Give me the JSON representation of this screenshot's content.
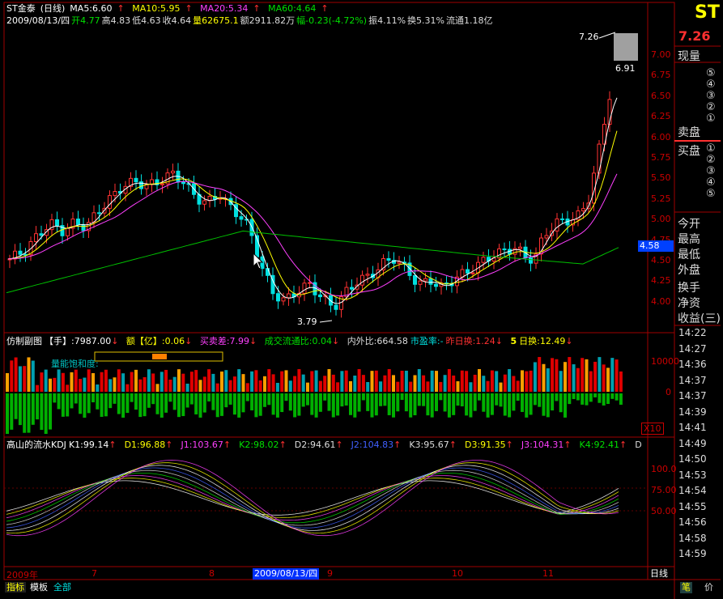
{
  "window": {
    "stock_name": "ST金泰",
    "period": "(日线)",
    "logo": "ST"
  },
  "header": {
    "ma5": "MA5:6.60",
    "ma10": "MA10:5.95",
    "ma20": "MA20:5.34",
    "ma60": "MA60:4.64",
    "row2_date": "2009/08/13/四",
    "open": "开4.77",
    "high": "高4.83",
    "low": "低4.63",
    "close": "收4.64",
    "vol": "量62675.1",
    "amount": "额2911.82万",
    "change": "幅-0.23(-4.72%)",
    "amp": "振4.11%",
    "turnover": "换5.31%",
    "float": "流通1.18亿"
  },
  "price_axis": [
    "7.00",
    "6.75",
    "6.50",
    "6.25",
    "6.00",
    "5.75",
    "5.50",
    "5.25",
    "5.00",
    "4.75",
    "4.50",
    "4.25",
    "4.00"
  ],
  "price_current_marker": "4.58",
  "annotations": {
    "high": "7.26",
    "high2": "6.91",
    "low": "3.79"
  },
  "sub1": {
    "title": "仿制副图",
    "unit1": "【手】",
    "val1": ":7987.00",
    "e_label": "额【亿】",
    "e_val": ":0.06",
    "buy_sell": "买卖差:7.99",
    "flow_ratio": "成交流通比:0.04",
    "inner_outer": "内外比:664.58",
    "pe": "市盈率:-",
    "yesterday": "昨日换:1.24",
    "n5": "5",
    "day_turn": "日换:12.49",
    "sat_label": "量能饱和度:",
    "axis_top": "10000",
    "axis_zero": "0",
    "factor": "X10"
  },
  "sub2": {
    "title": "高山的流水KDJ",
    "k1": "K1:99.14",
    "d1": "D1:96.88",
    "j1": "J1:103.67",
    "k2": "K2:98.02",
    "d2": "D2:94.61",
    "j2": "J2:104.83",
    "k3": "K3:95.67",
    "d3": "D3:91.35",
    "j3": "J3:104.31",
    "k4": "K4:92.41",
    "d4": "D",
    "axis": [
      "100.0",
      "75.00",
      "50.00"
    ]
  },
  "x_axis": {
    "year": "2009年",
    "m7": "7",
    "m8": "8",
    "date": "2009/08/13/四",
    "m9": "9",
    "m10": "10",
    "m11": "11",
    "period": "日线"
  },
  "tabs": [
    "指标",
    "模板",
    "全部"
  ],
  "right_panel": {
    "price": "7.26",
    "price_label": "现量",
    "sell_label": "卖盘",
    "buy_label": "买盘",
    "sell_levels": [
      "⑤",
      "④",
      "③",
      "②",
      "①"
    ],
    "buy_levels": [
      "①",
      "②",
      "③",
      "④",
      "⑤"
    ],
    "labels": [
      "今开",
      "最高",
      "最低",
      "外盘",
      "换手",
      "净资",
      "收益(三)"
    ],
    "times": [
      "14:22",
      "14:27",
      "14:36",
      "14:37",
      "14:37",
      "14:39",
      "14:41",
      "14:49",
      "14:50",
      "14:53",
      "14:54",
      "14:55",
      "14:56",
      "14:58",
      "14:59"
    ],
    "bottom_left": "笔",
    "bottom_right": "价"
  },
  "colors": {
    "up": "#ff3232",
    "down": "#00e0e0",
    "ma5": "#ffffff",
    "ma10": "#ffff00",
    "ma20": "#ff40ff",
    "ma60": "#00c000",
    "grid": "#c00000"
  }
}
